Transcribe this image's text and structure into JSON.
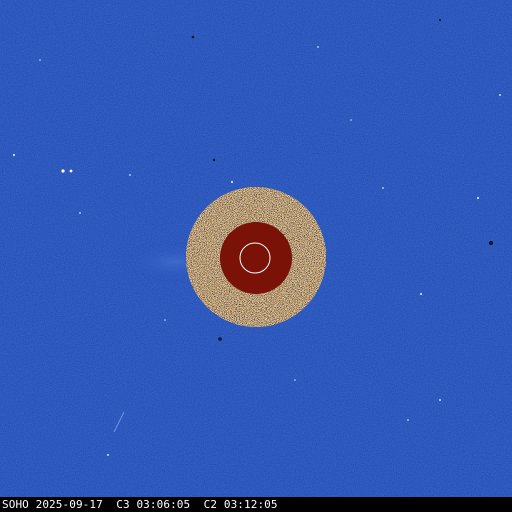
{
  "image": {
    "colors": {
      "background": "#1f48b4",
      "occulter_ring": "#d8c9a6",
      "occulter_disk": "#7a1207",
      "sun_outline": "#ffffff"
    }
  },
  "caption": {
    "text": "SOHO 2025-09-17  C3 03:06:05  C2 03:12:05"
  }
}
